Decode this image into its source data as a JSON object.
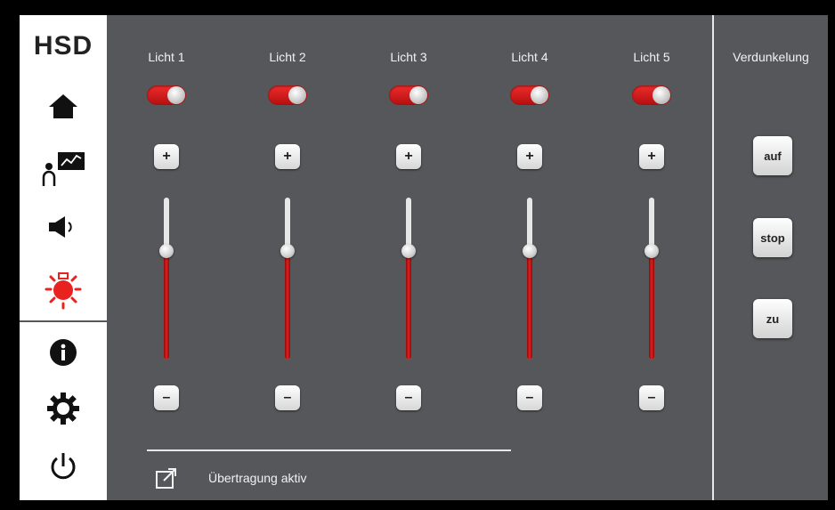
{
  "sidebar": {
    "logo": "HSD",
    "items": [
      {
        "name": "home-icon",
        "color": "#111111"
      },
      {
        "name": "presenter-chart-icon",
        "color": "#111111"
      },
      {
        "name": "speaker-icon",
        "color": "#111111"
      },
      {
        "name": "light-icon",
        "color": "#e8231f",
        "active": true
      },
      {
        "name": "info-icon",
        "color": "#111111"
      },
      {
        "name": "gear-icon",
        "color": "#111111"
      },
      {
        "name": "power-icon",
        "color": "#111111"
      }
    ]
  },
  "channels": [
    {
      "label": "Licht 1",
      "on": true,
      "level": 0.67
    },
    {
      "label": "Licht 2",
      "on": true,
      "level": 0.67
    },
    {
      "label": "Licht 3",
      "on": true,
      "level": 0.67
    },
    {
      "label": "Licht 4",
      "on": true,
      "level": 0.67
    },
    {
      "label": "Licht 5",
      "on": true,
      "level": 0.67
    }
  ],
  "buttons": {
    "plus": "+",
    "minus": "–"
  },
  "footer": {
    "status": "Übertragung aktiv",
    "icon": "external-link-icon"
  },
  "dimming": {
    "title": "Verdunkelung",
    "buttons": [
      "auf",
      "stop",
      "zu"
    ]
  },
  "colors": {
    "accent": "#e8231f",
    "background": "#55575a",
    "sidebar": "#ffffff"
  }
}
